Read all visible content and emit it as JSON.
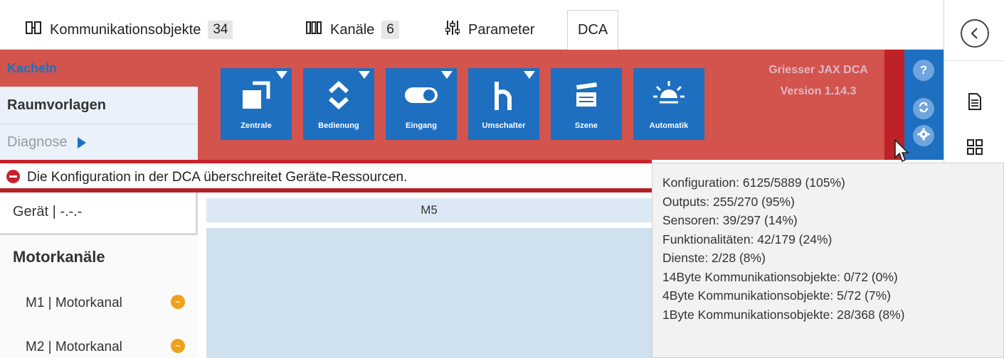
{
  "tabs": [
    {
      "label": "Kommunikationsobjekte",
      "count": "34",
      "icon": "com-objects-icon"
    },
    {
      "label": "Kanäle",
      "count": "6",
      "icon": "channels-icon"
    },
    {
      "label": "Parameter",
      "icon": "sliders-icon"
    },
    {
      "label": "DCA",
      "active": true
    }
  ],
  "header": {
    "kacheln": "Kacheln",
    "raumvorlagen": "Raumvorlagen",
    "diagnose": "Diagnose",
    "brand_line1": "Griesser JAX DCA",
    "brand_line2": "Version 1.14.3",
    "help_glyph": "?"
  },
  "tiles": [
    {
      "label": "Zentrale",
      "icon": "zentrale-icon"
    },
    {
      "label": "Bedienung",
      "icon": "up-down-icon"
    },
    {
      "label": "Eingang",
      "icon": "toggle-icon"
    },
    {
      "label": "Umschalter",
      "icon": "switch-icon"
    },
    {
      "label": "Szene",
      "icon": "clapper-icon"
    },
    {
      "label": "Automatik",
      "icon": "sun-icon"
    }
  ],
  "error": {
    "message": "Die Konfiguration in der DCA überschreitet Geräte-Ressourcen."
  },
  "left": {
    "geraet": "Gerät | -.-.-",
    "section_title": "Motorkanäle",
    "items": [
      {
        "label": "M1 | Motorkanal"
      },
      {
        "label": "M2 | Motorkanal"
      }
    ]
  },
  "main": {
    "column_title": "M5"
  },
  "tooltip": {
    "lines": [
      "Konfiguration: 6125/5889 (105%)",
      "Outputs: 255/270 (95%)",
      "Sensoren: 39/297 (14%)",
      "Funktionalitäten: 42/179 (24%)",
      "Dienste: 2/28 (8%)",
      "14Byte Kommunikationsobjekte: 0/72 (0%)",
      "4Byte Kommunikationsobjekte: 5/72 (7%)",
      "1Byte Kommunikationsobjekte: 28/368 (8%)"
    ]
  },
  "colors": {
    "header_red": "#d2544d",
    "error_red": "#c6222b",
    "tile_blue": "#1e6fc0",
    "brand_pink": "#e0b6c7"
  }
}
